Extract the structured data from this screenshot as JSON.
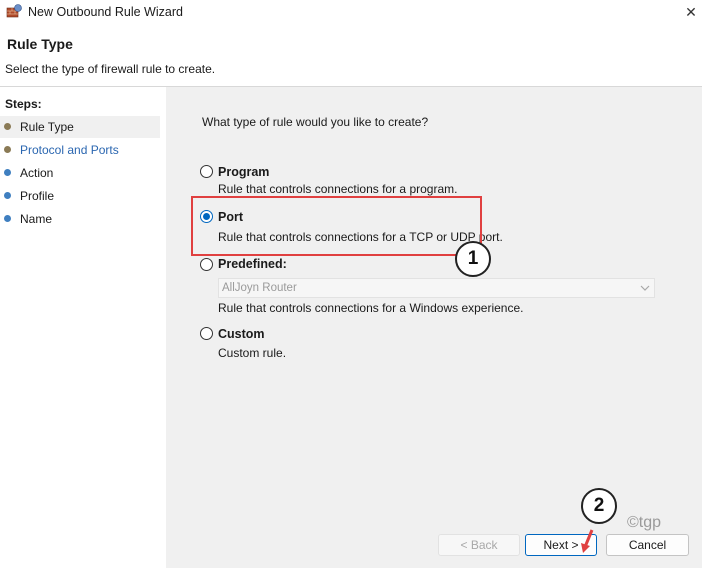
{
  "window": {
    "title": "New Outbound Rule Wizard",
    "close_glyph": "✕"
  },
  "header": {
    "title": "Rule Type",
    "subtitle": "Select the type of firewall rule to create."
  },
  "steps": {
    "heading": "Steps:",
    "items": [
      {
        "label": "Rule Type",
        "state": "current"
      },
      {
        "label": "Protocol and Ports",
        "state": "link"
      },
      {
        "label": "Action",
        "state": "normal"
      },
      {
        "label": "Profile",
        "state": "normal"
      },
      {
        "label": "Name",
        "state": "normal"
      }
    ]
  },
  "main": {
    "question": "What type of rule would you like to create?",
    "options": [
      {
        "label": "Program",
        "description": "Rule that controls connections for a program.",
        "selected": false
      },
      {
        "label": "Port",
        "description": "Rule that controls connections for a TCP or UDP port.",
        "selected": true
      },
      {
        "label": "Predefined:",
        "description": "Rule that controls connections for a Windows experience.",
        "selected": false
      },
      {
        "label": "Custom",
        "description": "Custom rule.",
        "selected": false
      }
    ],
    "predefined_dropdown": {
      "value": "AllJoyn Router",
      "enabled": false
    }
  },
  "annotations": {
    "callout_1": "1",
    "callout_2": "2",
    "watermark": "©tgp"
  },
  "buttons": {
    "back": "< Back",
    "next": "Next >",
    "cancel": "Cancel"
  },
  "colors": {
    "accent": "#0067c0",
    "link": "#2a66b0",
    "highlight": "#e04040"
  },
  "icons": {
    "app": "firewall-wizard-icon",
    "step_bullet": "bullet-icon",
    "dropdown": "chevron-down-icon"
  }
}
